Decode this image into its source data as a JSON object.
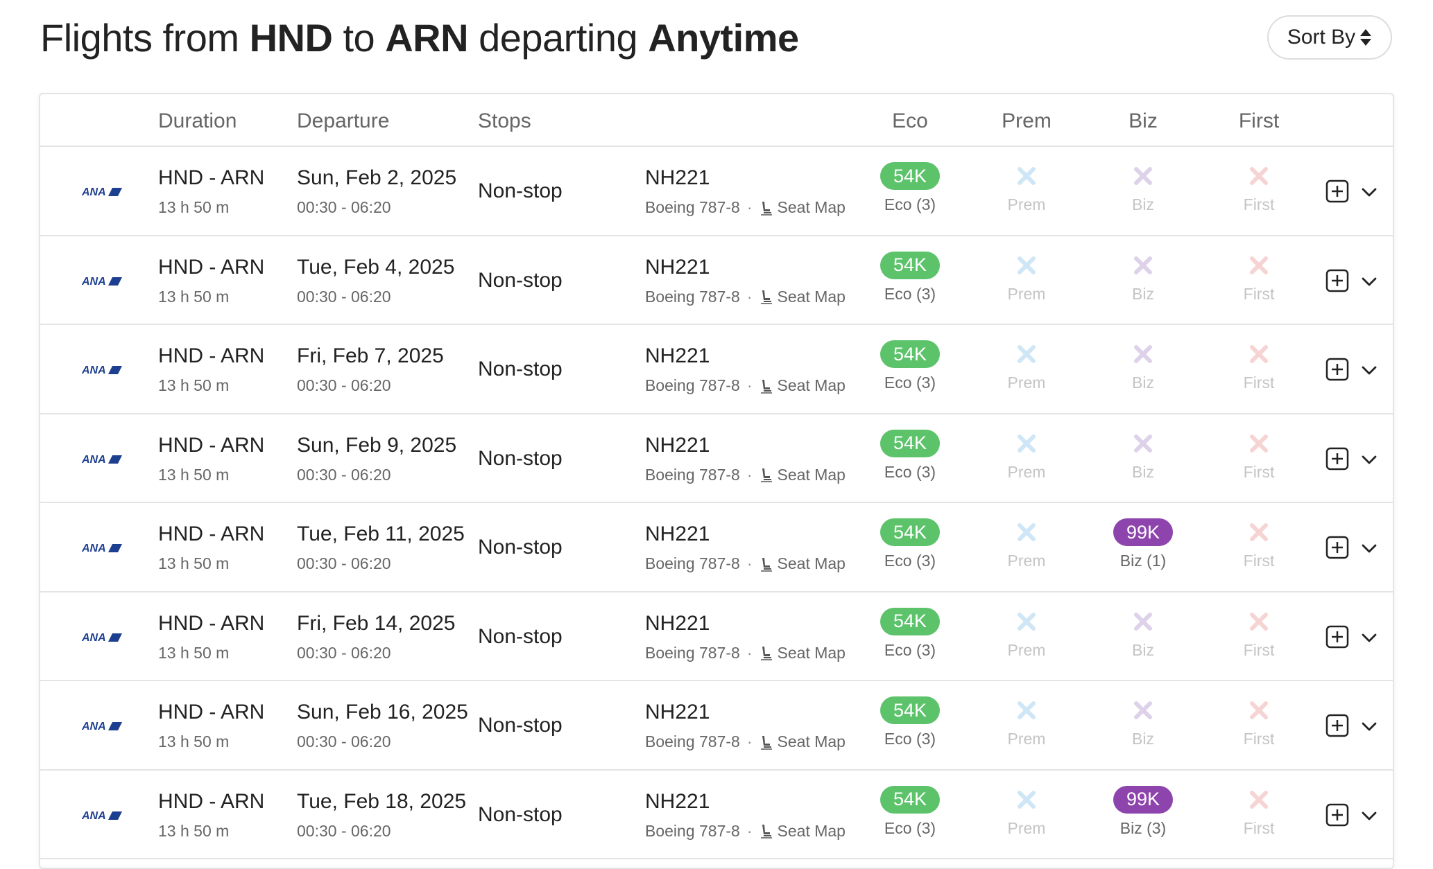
{
  "header": {
    "title_prefix": "Flights from ",
    "origin": "HND",
    "to_word": " to ",
    "destination": "ARN",
    "departing_word": " departing ",
    "when": "Anytime",
    "sort_label": "Sort By"
  },
  "table": {
    "columns": {
      "duration": "Duration",
      "departure": "Departure",
      "stops": "Stops",
      "eco": "Eco",
      "prem": "Prem",
      "biz": "Biz",
      "first": "First"
    },
    "airline_logo_text": "ANA",
    "seat_map_label": "Seat Map",
    "dot": "·",
    "na_labels": {
      "prem": "Prem",
      "biz": "Biz",
      "first": "First"
    },
    "colors": {
      "eco_pill": "#5cc36b",
      "biz_pill": "#8e44ad",
      "logo_blue": "#1d3f8f",
      "x_blue": "#cfe6f6",
      "x_purple": "#ddd2ea",
      "x_red": "#f6d4d4"
    },
    "rows": [
      {
        "route": "HND - ARN",
        "duration": "13 h 50 m",
        "date": "Sun, Feb 2, 2025",
        "time": "00:30 - 06:20",
        "stops": "Non-stop",
        "flight": "NH221",
        "aircraft": "Boeing 787-8",
        "eco_price": "54K",
        "eco_label": "Eco (3)",
        "biz_price": "",
        "biz_label": ""
      },
      {
        "route": "HND - ARN",
        "duration": "13 h 50 m",
        "date": "Tue, Feb 4, 2025",
        "time": "00:30 - 06:20",
        "stops": "Non-stop",
        "flight": "NH221",
        "aircraft": "Boeing 787-8",
        "eco_price": "54K",
        "eco_label": "Eco (3)",
        "biz_price": "",
        "biz_label": ""
      },
      {
        "route": "HND - ARN",
        "duration": "13 h 50 m",
        "date": "Fri, Feb 7, 2025",
        "time": "00:30 - 06:20",
        "stops": "Non-stop",
        "flight": "NH221",
        "aircraft": "Boeing 787-8",
        "eco_price": "54K",
        "eco_label": "Eco (3)",
        "biz_price": "",
        "biz_label": ""
      },
      {
        "route": "HND - ARN",
        "duration": "13 h 50 m",
        "date": "Sun, Feb 9, 2025",
        "time": "00:30 - 06:20",
        "stops": "Non-stop",
        "flight": "NH221",
        "aircraft": "Boeing 787-8",
        "eco_price": "54K",
        "eco_label": "Eco (3)",
        "biz_price": "",
        "biz_label": ""
      },
      {
        "route": "HND - ARN",
        "duration": "13 h 50 m",
        "date": "Tue, Feb 11, 2025",
        "time": "00:30 - 06:20",
        "stops": "Non-stop",
        "flight": "NH221",
        "aircraft": "Boeing 787-8",
        "eco_price": "54K",
        "eco_label": "Eco (3)",
        "biz_price": "99K",
        "biz_label": "Biz (1)"
      },
      {
        "route": "HND - ARN",
        "duration": "13 h 50 m",
        "date": "Fri, Feb 14, 2025",
        "time": "00:30 - 06:20",
        "stops": "Non-stop",
        "flight": "NH221",
        "aircraft": "Boeing 787-8",
        "eco_price": "54K",
        "eco_label": "Eco (3)",
        "biz_price": "",
        "biz_label": ""
      },
      {
        "route": "HND - ARN",
        "duration": "13 h 50 m",
        "date": "Sun, Feb 16, 2025",
        "time": "00:30 - 06:20",
        "stops": "Non-stop",
        "flight": "NH221",
        "aircraft": "Boeing 787-8",
        "eco_price": "54K",
        "eco_label": "Eco (3)",
        "biz_price": "",
        "biz_label": ""
      },
      {
        "route": "HND - ARN",
        "duration": "13 h 50 m",
        "date": "Tue, Feb 18, 2025",
        "time": "00:30 - 06:20",
        "stops": "Non-stop",
        "flight": "NH221",
        "aircraft": "Boeing 787-8",
        "eco_price": "54K",
        "eco_label": "Eco (3)",
        "biz_price": "99K",
        "biz_label": "Biz (3)"
      }
    ]
  }
}
